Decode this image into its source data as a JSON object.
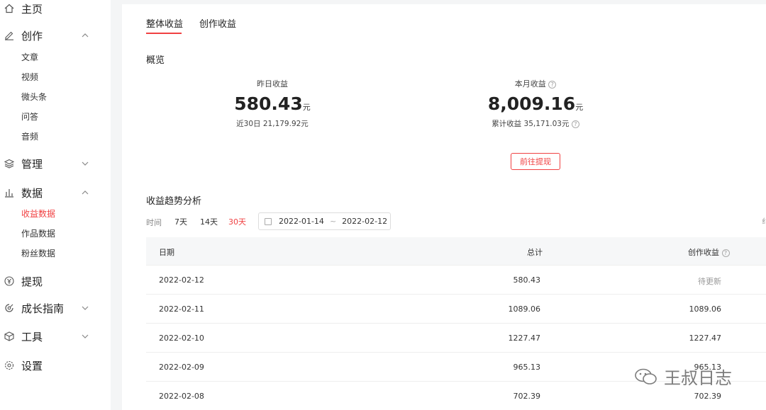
{
  "sidebar": {
    "home": "主页",
    "create": "创作",
    "create_items": [
      "文章",
      "视频",
      "微头条",
      "问答",
      "音频"
    ],
    "manage": "管理",
    "data": "数据",
    "data_items": [
      "收益数据",
      "作品数据",
      "粉丝数据"
    ],
    "withdraw": "提现",
    "growth": "成长指南",
    "tools": "工具",
    "settings": "设置"
  },
  "tabs": [
    "整体收益",
    "创作收益"
  ],
  "overview": {
    "title": "概览",
    "yesterday_label": "昨日收益",
    "yesterday_value": "580.43",
    "unit": "元",
    "last30": "近30日 21,179.92元",
    "month_label": "本月收益",
    "month_value": "8,009.16",
    "cumulative": "累计收益 35,171.03元",
    "withdraw_button": "前往提现"
  },
  "trend": {
    "title": "收益趋势分析",
    "time_label": "时间",
    "ranges": [
      "7天",
      "14天",
      "30天"
    ],
    "active_range": "30天",
    "date_start": "2022-01-14",
    "date_sep": "~",
    "date_end": "2022-02-12"
  },
  "table": {
    "headers": [
      "日期",
      "总计",
      "创作收益"
    ],
    "rows": [
      [
        "2022-02-12",
        "580.43",
        "待更新"
      ],
      [
        "2022-02-11",
        "1089.06",
        "1089.06"
      ],
      [
        "2022-02-10",
        "1227.47",
        "1227.47"
      ],
      [
        "2022-02-09",
        "965.13",
        "965.13"
      ],
      [
        "2022-02-08",
        "702.39",
        "702.39"
      ]
    ]
  },
  "watermark": "王叔日志",
  "edge_glyph": "纟",
  "colors": {
    "accent": "#f04142",
    "background": "#f4f5f6"
  }
}
